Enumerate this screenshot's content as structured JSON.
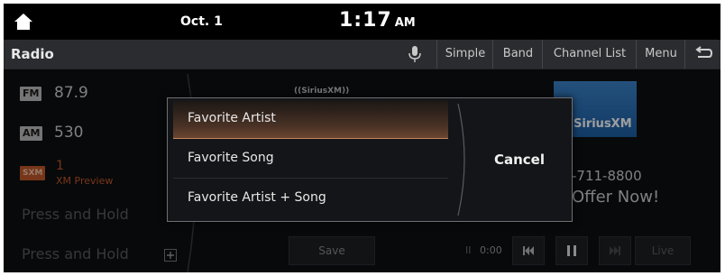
{
  "status": {
    "date": "Oct. 1",
    "time": "1:17",
    "ampm": "AM"
  },
  "header": {
    "title": "Radio",
    "buttons": [
      "Simple",
      "Band",
      "Channel List",
      "Menu"
    ]
  },
  "presets": [
    {
      "badge": "FM",
      "label": "87.9"
    },
    {
      "badge": "AM",
      "label": "530"
    },
    {
      "badge": "SXM",
      "label": "1",
      "sublabel": "XM Preview"
    }
  ],
  "press_hold": [
    "Press and Hold",
    "Press and Hold"
  ],
  "station": {
    "logo_small": "((SiriusXM))",
    "logo_card": "SiriusXM",
    "phone": "-711-8800",
    "offer": "Offer Now!"
  },
  "playback": {
    "save_label": "Save",
    "time": "0:00",
    "live_label": "Live"
  },
  "dialog": {
    "options": [
      "Favorite Artist",
      "Favorite Song",
      "Favorite Artist + Song"
    ],
    "cancel_label": "Cancel"
  },
  "colors": {
    "accent": "#c2835a",
    "sxm_badge": "#c0582b",
    "logo_blue": "#2a6fb5"
  },
  "icons": [
    "home-icon",
    "mic-icon",
    "back-icon",
    "plus-icon",
    "previous-icon",
    "pause-icon",
    "next-icon"
  ]
}
